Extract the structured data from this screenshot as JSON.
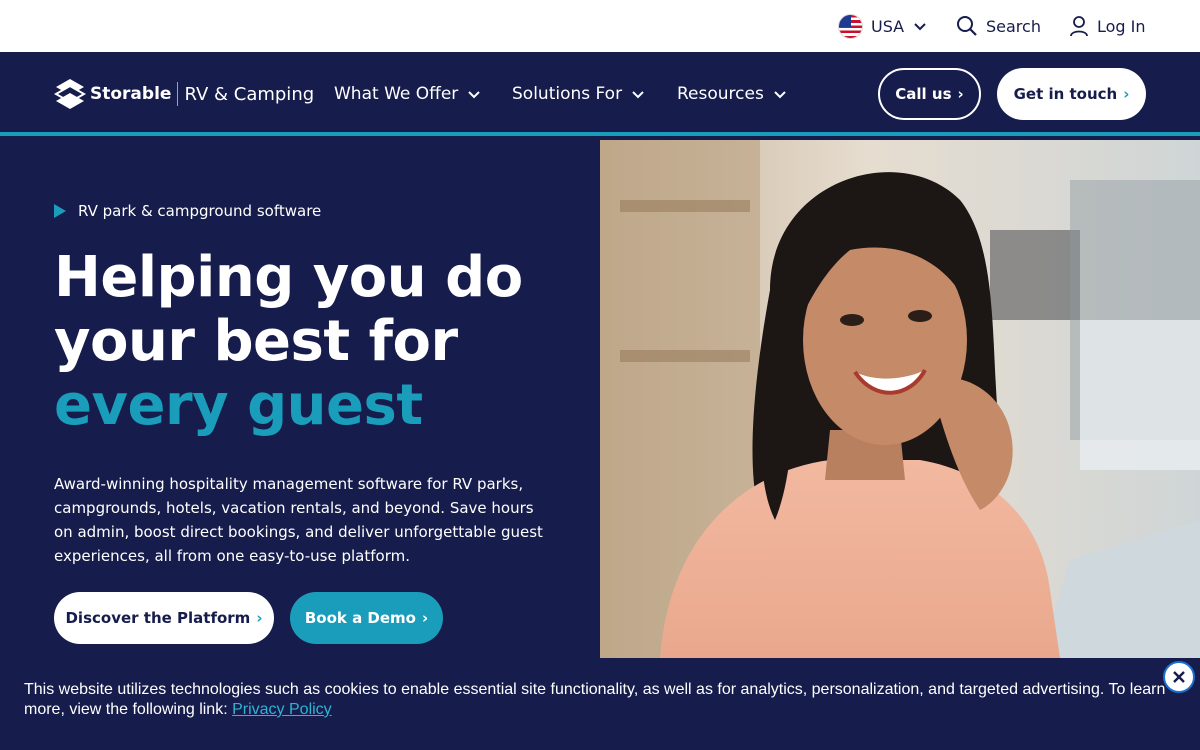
{
  "topbar": {
    "country_label": "USA",
    "search_label": "Search",
    "login_label": "Log In"
  },
  "nav": {
    "brand": "Storable",
    "brand_sub": "RV & Camping",
    "menu": [
      {
        "label": "What We Offer"
      },
      {
        "label": "Solutions For"
      },
      {
        "label": "Resources"
      }
    ],
    "call_label": "Call us",
    "touch_label": "Get in touch"
  },
  "hero": {
    "eyebrow": "RV park & campground software",
    "headline_line1": "Helping you do",
    "headline_line2": "your best for",
    "headline_accent": "every guest",
    "description": "Award-winning hospitality management software for RV parks, campgrounds, hotels, vacation rentals, and beyond. Save hours on admin, boost direct bookings, and deliver unforgettable guest experiences, all from one easy-to-use platform.",
    "discover_label": "Discover the Platform",
    "demo_label": "Book a Demo"
  },
  "cookie": {
    "text": "This website utilizes technologies such as cookies to enable essential site functionality, as well as for analytics, personalization, and targeted advertising. To learn more, view the following link:",
    "link_label": "Privacy Policy"
  },
  "colors": {
    "navy": "#161c4b",
    "teal": "#1a9dbb",
    "white": "#ffffff"
  },
  "icons": [
    "us-flag-icon",
    "chevron-down-icon",
    "search-icon",
    "user-icon",
    "chevron-right-icon",
    "close-icon",
    "storable-logo"
  ]
}
